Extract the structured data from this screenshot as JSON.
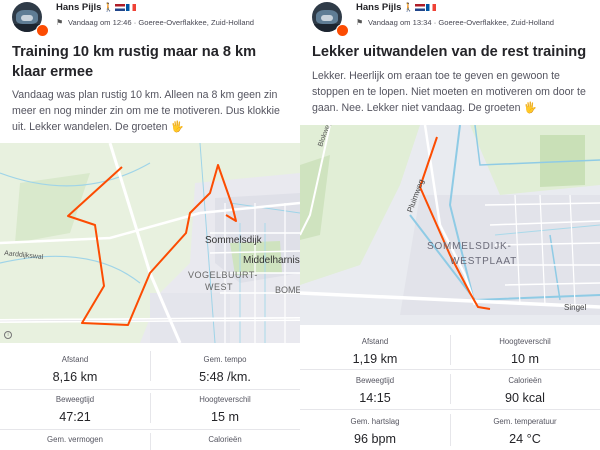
{
  "activities": [
    {
      "athlete": "Hans Pijls",
      "name_emoji": "🚶",
      "time": "Vandaag om 12:46",
      "location": "Goeree-Overflakkee, Zuid-Holland",
      "title": "Training 10 km rustig maar na 8 km klaar ermee",
      "description": "Vandaag was plan rustig 10 km. Alleen na 8 km geen zin meer en nog minder zin om me te motiveren. Dus klokkie uit. Lekker wandelen. De groeten",
      "wave": "🖐",
      "map": {
        "labels": [
          "Sommelsdijk",
          "Middelharnis",
          "VOGELBUURT-",
          "WEST",
          "BOME",
          "Aarddijkswal"
        ],
        "route_color": "#fc4c02"
      },
      "stats": [
        {
          "label": "Afstand",
          "value": "8,16 km"
        },
        {
          "label": "Gem. tempo",
          "value": "5:48 /km."
        },
        {
          "label": "Beweegtijd",
          "value": "47:21"
        },
        {
          "label": "Hoogteverschil",
          "value": "15 m"
        },
        {
          "label": "Gem. vermogen",
          "value": ""
        },
        {
          "label": "Calorieën",
          "value": ""
        }
      ]
    },
    {
      "athlete": "Hans Pijls",
      "name_emoji": "🚶",
      "time": "Vandaag om 13:34",
      "location": "Goeree-Overflakkee, Zuid-Holland",
      "title": "Lekker uitwandelen van de rest training",
      "description": "Lekker. Heerlijk om eraan toe te geven en gewoon te stoppen en te lopen. Niet moeten en motiveren om door te gaan.  Nee. Lekker niet vandaag. De groeten",
      "wave": "🖐",
      "map": {
        "labels": [
          "SOMMELSDIJK-",
          "WESTPLAAT",
          "Pluimweg",
          "Singel",
          "Blokweg"
        ],
        "route_color": "#fc4c02"
      },
      "stats": [
        {
          "label": "Afstand",
          "value": "1,19 km"
        },
        {
          "label": "Hoogteverschil",
          "value": "10 m"
        },
        {
          "label": "Beweegtijd",
          "value": "14:15"
        },
        {
          "label": "Calorieën",
          "value": "90 kcal"
        },
        {
          "label": "Gem. hartslag",
          "value": "96 bpm"
        },
        {
          "label": "Gem. temperatuur",
          "value": "24 °C"
        }
      ]
    }
  ]
}
